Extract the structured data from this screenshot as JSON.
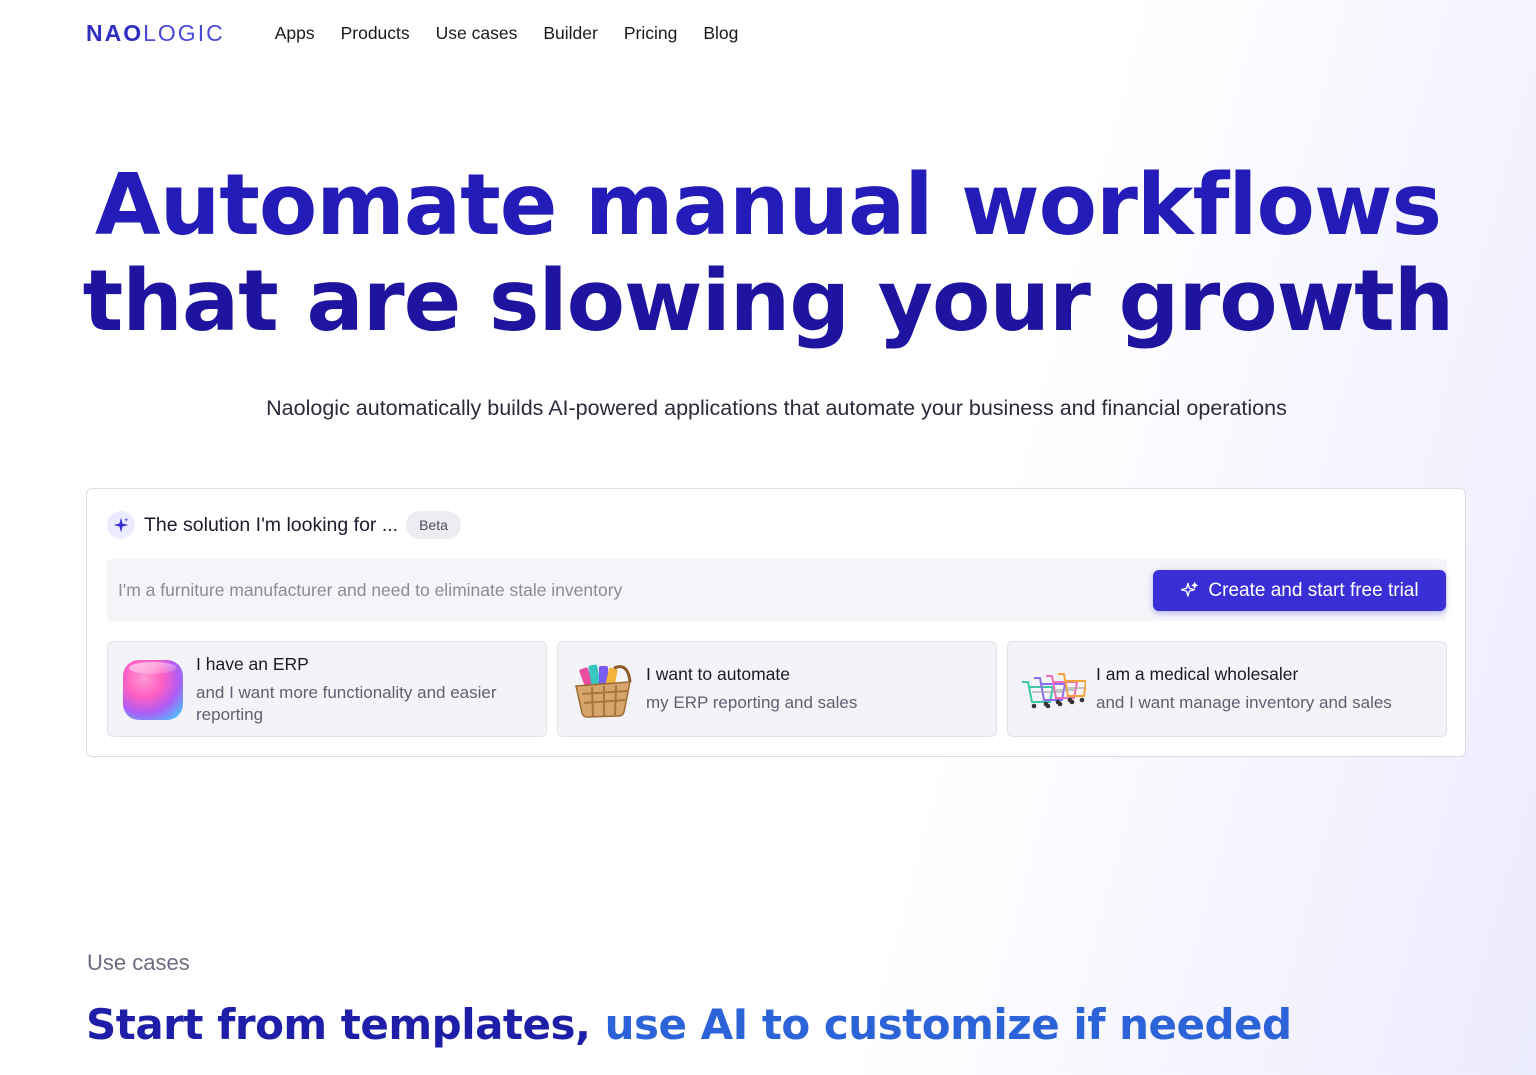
{
  "nav": {
    "logo_bold": "NAO",
    "logo_light": "LOGIC",
    "items": [
      {
        "label": "Apps"
      },
      {
        "label": "Products"
      },
      {
        "label": "Use cases"
      },
      {
        "label": "Builder"
      },
      {
        "label": "Pricing"
      },
      {
        "label": "Blog"
      }
    ]
  },
  "hero": {
    "title_line1": "Automate manual workflows",
    "title_line2": "that are slowing your growth",
    "subtitle": "Naologic automatically builds AI-powered applications that automate your business and financial operations"
  },
  "solution_finder": {
    "icon": "sparkle-icon",
    "label": "The solution I'm looking for ...",
    "badge": "Beta",
    "input_value": "",
    "input_placeholder": "I'm a furniture manufacturer and need to eliminate stale inventory",
    "cta_label": "Create and start free trial",
    "options": [
      {
        "icon": "erp-cube-icon",
        "title": "I have an ERP",
        "subtitle": "and I want more functionality and easier reporting"
      },
      {
        "icon": "shopping-basket-icon",
        "title": "I want to automate",
        "subtitle": "my ERP reporting and sales"
      },
      {
        "icon": "shopping-carts-icon",
        "title": "I am a medical wholesaler",
        "subtitle": "and I want manage inventory and sales"
      }
    ]
  },
  "use_cases": {
    "label": "Use cases",
    "title_part1": "Start from templates, ",
    "title_part2": "use AI to customize if needed"
  },
  "colors": {
    "brand": "#2f2fbf",
    "hero_title": "#241cb8",
    "cta": "#3a2fd6",
    "accent_blue": "#2d63d8"
  }
}
